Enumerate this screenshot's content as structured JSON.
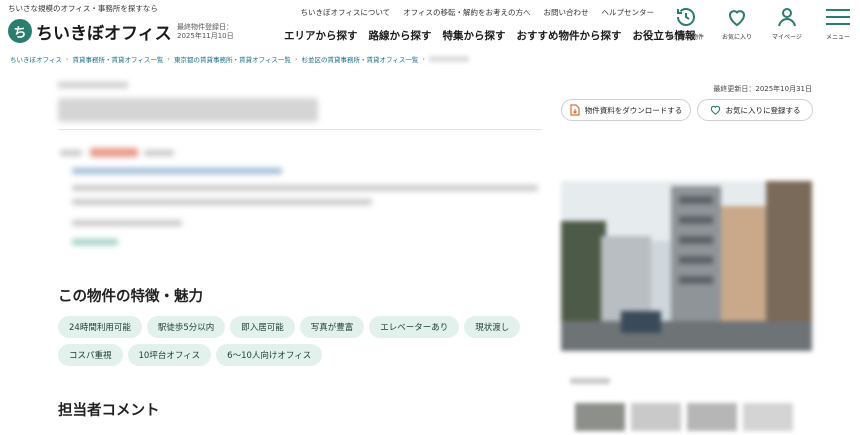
{
  "header": {
    "tagline": "ちいさな規模のオフィス・事務所を探すなら",
    "logo_text": "ちいきぼオフィス",
    "reg_label": "最終物件登録日：",
    "reg_date": "2025年11月10日",
    "top_links": [
      "ちいきぼオフィスについて",
      "オフィスの移転・解約をお考えの方へ",
      "お問い合わせ",
      "ヘルプセンター"
    ],
    "main_nav": [
      "エリアから探す",
      "路線から探す",
      "特集から探す",
      "おすすめ物件から探す",
      "お役立ち情報"
    ],
    "icons": [
      {
        "name": "recently-viewed-icon",
        "label": "最近見た物件"
      },
      {
        "name": "favorite-heart-icon",
        "label": "お気に入り"
      },
      {
        "name": "mypage-person-icon",
        "label": "マイページ"
      },
      {
        "name": "menu-hamburger-icon",
        "label": "メニュー"
      }
    ],
    "accent": "#2b7e6d"
  },
  "breadcrumb": [
    "ちいきぼオフィス",
    "賃貸事務所・賃貸オフィス一覧",
    "東京都の賃貸事務所・賃貸オフィス一覧",
    "杉並区の賃貸事務所・賃貸オフィス一覧"
  ],
  "last_updated": "最終更新日：2025年10月31日",
  "actions": {
    "download": "物件資料をダウンロードする",
    "favorite": "お気に入りに登録する"
  },
  "features": {
    "title": "この物件の特徴・魅力",
    "tags": [
      "24時間利用可能",
      "駅徒歩5分以内",
      "即入居可能",
      "写真が豊富",
      "エレベーターあり",
      "現状渡し",
      "コスパ重視",
      "10坪台オフィス",
      "6〜10人向けオフィス"
    ]
  },
  "comment": {
    "title": "担当者コメント"
  }
}
